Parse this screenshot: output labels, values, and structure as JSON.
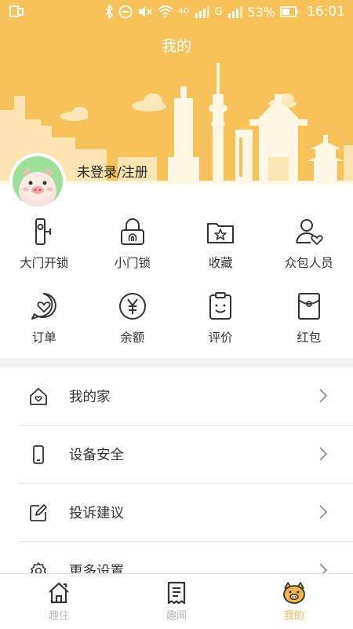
{
  "status_bar": {
    "signal_g": "G",
    "battery": "53%",
    "time": "16:01",
    "network": "4G"
  },
  "header": {
    "title": "我的"
  },
  "profile": {
    "login_text": "未登录/注册"
  },
  "quick_actions": [
    {
      "label": "大门开锁",
      "icon": "door-unlock-icon"
    },
    {
      "label": "小门锁",
      "icon": "fingerprint-lock-icon"
    },
    {
      "label": "收藏",
      "icon": "favorites-folder-icon"
    },
    {
      "label": "众包人员",
      "icon": "crowdsource-person-icon"
    },
    {
      "label": "订单",
      "icon": "order-heart-icon"
    },
    {
      "label": "余额",
      "icon": "yuan-balance-icon"
    },
    {
      "label": "评价",
      "icon": "review-icon"
    },
    {
      "label": "红包",
      "icon": "red-envelope-icon"
    }
  ],
  "menu": [
    {
      "label": "我的家",
      "icon": "home-heart-icon"
    },
    {
      "label": "设备安全",
      "icon": "phone-device-icon"
    },
    {
      "label": "投诉建议",
      "icon": "edit-feedback-icon"
    },
    {
      "label": "更多设置",
      "icon": "gear-icon"
    }
  ],
  "tabbar": [
    {
      "label": "趣住",
      "icon": "house-tab-icon",
      "active": false
    },
    {
      "label": "趣闻",
      "icon": "news-tab-icon",
      "active": false
    },
    {
      "label": "我的",
      "icon": "pig-tab-icon",
      "active": true
    }
  ],
  "colors": {
    "header_bg": "#F7C25A",
    "accent": "#F2B64C",
    "text": "#333333",
    "divider": "#EFEFEF"
  }
}
